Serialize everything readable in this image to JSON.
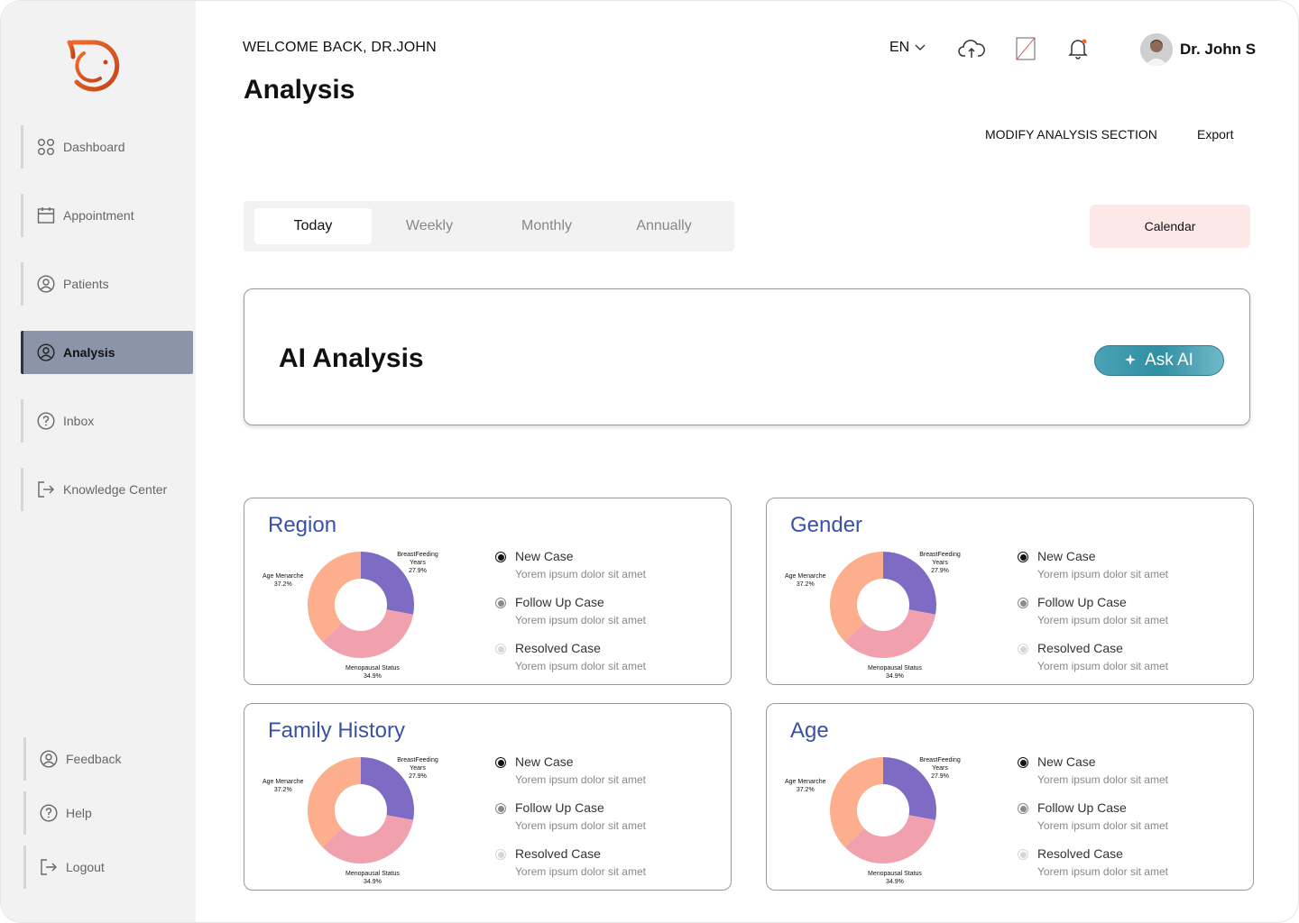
{
  "colors": {
    "sidebar_bg": "#f2f2f2",
    "active_nav": "#8b94a8",
    "calendar_bg": "#fde8e8",
    "ask_ai": "#3a9bad",
    "title_blue": "#3852a4",
    "slice_purple": "#7d6bc4",
    "slice_pink": "#f0a1ad",
    "slice_peach": "#fdae8c"
  },
  "sidebar": {
    "items": [
      {
        "label": "Dashboard",
        "icon": "grid-icon"
      },
      {
        "label": "Appointment",
        "icon": "calendar-icon"
      },
      {
        "label": "Patients",
        "icon": "user-circle-icon"
      },
      {
        "label": "Analysis",
        "icon": "user-circle-icon",
        "active": true
      },
      {
        "label": "Inbox",
        "icon": "question-circle-icon"
      },
      {
        "label": "Knowledge Center",
        "icon": "logout-arrow-icon"
      }
    ],
    "bottom": [
      {
        "label": "Feedback",
        "icon": "user-circle-icon"
      },
      {
        "label": "Help",
        "icon": "question-circle-icon"
      },
      {
        "label": "Logout",
        "icon": "logout-arrow-icon"
      }
    ]
  },
  "header": {
    "welcome": "WELCOME BACK, DR.JOHN",
    "title": "Analysis",
    "lang": "EN",
    "user_name": "Dr. John S",
    "modify": "MODIFY ANALYSIS SECTION",
    "export": "Export"
  },
  "tabs": [
    "Today",
    "Weekly",
    "Monthly",
    "Annually"
  ],
  "calendar": "Calendar",
  "ai": {
    "title": "AI Analysis",
    "ask": "Ask AI"
  },
  "cards": [
    {
      "title": "Region"
    },
    {
      "title": "Gender"
    },
    {
      "title": "Family History"
    },
    {
      "title": "Age"
    }
  ],
  "chart_data": {
    "type": "pie",
    "slices": [
      {
        "name": "BreastFeeding Years",
        "value": 27.9,
        "value_label": "27.9%",
        "color": "#7d6bc4"
      },
      {
        "name": "Menopausal Status",
        "value": 34.9,
        "value_label": "34.9%",
        "color": "#f0a1ad"
      },
      {
        "name": "Age Menarche",
        "value": 37.2,
        "value_label": "37.2%",
        "color": "#fdae8c"
      }
    ]
  },
  "legend": [
    {
      "name": "New Case",
      "desc": "Yorem ipsum dolor sit amet",
      "color": "#111111"
    },
    {
      "name": "Follow Up Case",
      "desc": "Yorem ipsum dolor sit amet",
      "color": "#8a8a8a"
    },
    {
      "name": "Resolved Case",
      "desc": "Yorem ipsum dolor sit amet",
      "color": "#d6d6d6"
    }
  ]
}
